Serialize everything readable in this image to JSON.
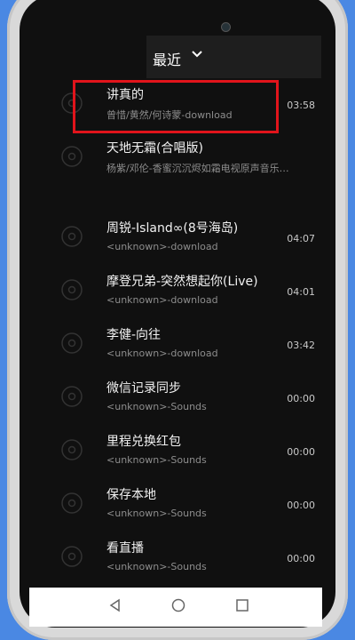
{
  "header": {
    "title": "最近",
    "chevron_icon": "chevron-down-icon"
  },
  "songs": [
    {
      "title": "讲真的",
      "subtitle": "曾惜/黄然/何诗蒙-download",
      "duration": "03:58",
      "highlighted": true
    },
    {
      "title": "天地无霜(合唱版)",
      "subtitle": "杨紫/邓伦-香蜜沉沉烬如霜电视原声音乐…",
      "duration": ""
    },
    {
      "title": "周锐-Island∞(8号海岛)",
      "subtitle": "<unknown>-download",
      "duration": "04:07"
    },
    {
      "title": "摩登兄弟-突然想起你(Live)",
      "subtitle": "<unknown>-download",
      "duration": "04:01"
    },
    {
      "title": "李健-向往",
      "subtitle": "<unknown>-download",
      "duration": "03:42"
    },
    {
      "title": "微信记录同步",
      "subtitle": "<unknown>-Sounds",
      "duration": "00:00"
    },
    {
      "title": "里程兑换红包",
      "subtitle": "<unknown>-Sounds",
      "duration": "00:00"
    },
    {
      "title": "保存本地",
      "subtitle": "<unknown>-Sounds",
      "duration": "00:00"
    },
    {
      "title": "看直播",
      "subtitle": "<unknown>-Sounds",
      "duration": "00:00"
    }
  ],
  "navbar": {
    "back_icon": "back-triangle-icon",
    "home_icon": "home-circle-icon",
    "recents_icon": "recents-square-icon"
  },
  "colors": {
    "background": "#4a88e3",
    "screen": "#101010",
    "highlight": "#e1141b"
  }
}
